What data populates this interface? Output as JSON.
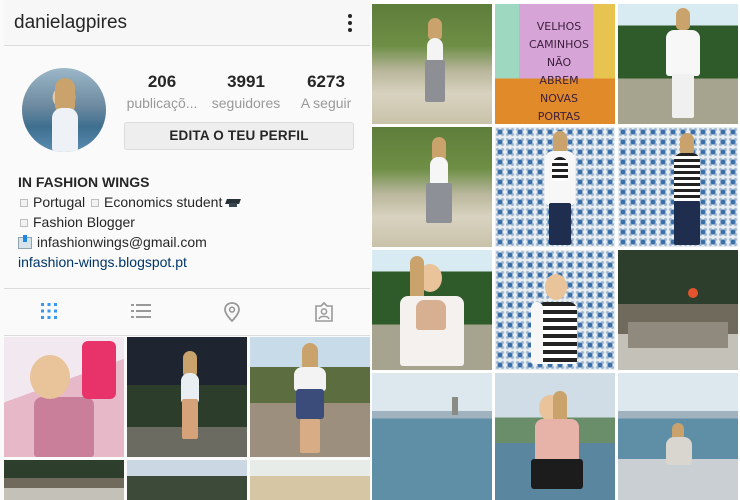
{
  "profile": {
    "username": "danielagpires",
    "stats": [
      {
        "value": "206",
        "label": "publicaçõ..."
      },
      {
        "value": "3991",
        "label": "seguidores"
      },
      {
        "value": "6273",
        "label": "A seguir"
      }
    ],
    "edit_button_label": "EDITA O TEU PERFIL",
    "bio": {
      "name": "IN FASHION WINGS",
      "line1_a": "Portugal",
      "line1_b": "Economics student",
      "line2": "Fashion Blogger",
      "email": "infashionwings@gmail.com",
      "link": "infashion-wings.blogspot.pt"
    }
  },
  "tabs": [
    {
      "icon": "grid-icon",
      "active": true
    },
    {
      "icon": "list-icon",
      "active": false
    },
    {
      "icon": "location-pin-icon",
      "active": false
    },
    {
      "icon": "tagged-person-icon",
      "active": false
    }
  ],
  "door_graffiti": "VELHOS CAMINHOS NÃO ABREM NOVAS PORTAS",
  "colors": {
    "accent_blue": "#3897f0",
    "link_blue": "#003569",
    "icon_gray": "#999999",
    "text_dark": "#262626"
  }
}
